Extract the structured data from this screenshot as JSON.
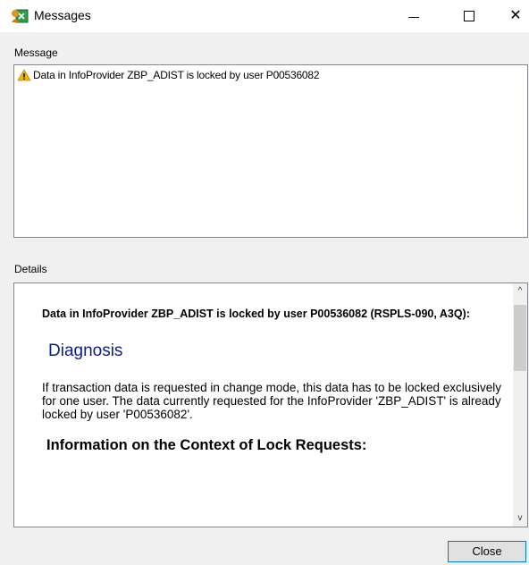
{
  "window": {
    "title": "Messages",
    "minimize_icon": "minimize-icon",
    "maximize_icon": "maximize-icon",
    "close_glyph": "✕"
  },
  "message_section": {
    "label": "Message",
    "items": [
      {
        "icon": "warning-icon",
        "text": "Data in InfoProvider ZBP_ADIST is locked by user P00536082"
      }
    ]
  },
  "details_section": {
    "label": "Details",
    "heading": "Data in InfoProvider ZBP_ADIST is locked by user P00536082 (RSPLS-090, A3Q):",
    "diagnosis_title": "Diagnosis",
    "diagnosis_text": " If transaction data is requested in change mode, this data has to be locked exclusively for one user. The data currently requested for the InfoProvider 'ZBP_ADIST' is already locked by user 'P00536082'.",
    "info_heading": "Information on the Context of Lock Requests:"
  },
  "scrollbar": {
    "up_glyph": "^",
    "down_glyph": "v"
  },
  "footer": {
    "close_label": "Close"
  },
  "colors": {
    "diagnosis": "#0c1d8f",
    "accent_border": "#0078d7",
    "warning": "#f2b705"
  }
}
